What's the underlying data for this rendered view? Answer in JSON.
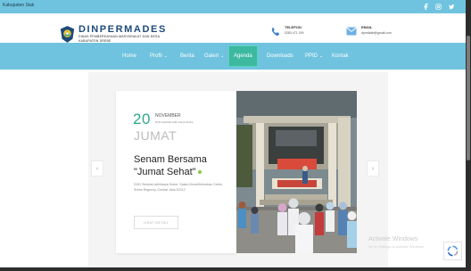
{
  "topbar": {
    "site_text": "Kabupaten Siak",
    "social_icons": [
      "facebook-icon",
      "instagram-icon",
      "twitter-icon"
    ]
  },
  "brand": {
    "name": "DINPERMADES",
    "subtitle_1": "DINAS PEMBERDAYAAN MASYARAKAT DAN DESA",
    "subtitle_2": "KABUPATEN SREBE"
  },
  "contact": {
    "phone_label": "TELEPON",
    "phone_value": "0283 471 199",
    "email_label": "EMAIL",
    "email_value": "dpmdkab@gmail.com"
  },
  "nav": {
    "items": [
      {
        "label": "Home",
        "caret": ""
      },
      {
        "label": "Profil",
        "caret": "⌄"
      },
      {
        "label": "Berita",
        "caret": ""
      },
      {
        "label": "Galeri",
        "caret": "⌄"
      },
      {
        "label": "Agenda",
        "caret": "",
        "active": true
      },
      {
        "label": "Downloads",
        "caret": ""
      },
      {
        "label": "PPID",
        "caret": "⌄"
      },
      {
        "label": "Kontak",
        "caret": ""
      }
    ]
  },
  "slider": {
    "prev_arrow": "‹",
    "next_arrow": "›",
    "event": {
      "day": "20",
      "month": "NOVEMBER",
      "author": "DOD Sekolah Adhi Karya Srebe",
      "weekday": "JUMAT",
      "title": "Senam Bersama \"Jumat Sehat\"",
      "excerpt": "DOD Sekolah Adhikarya Srebe, Saiam Desa/Kelurahan Srebe, Srebe Regency, Central Java 52212",
      "button_label": "LIHAT DETAIL"
    }
  },
  "watermark": {
    "title": "Activate Windows",
    "subtitle": "Go to Settings to activate Windows."
  },
  "colors": {
    "nav_bg": "#6fc3df",
    "active_nav": "#3db9a0",
    "accent": "#2ea88d",
    "brand": "#1e4a7a"
  }
}
